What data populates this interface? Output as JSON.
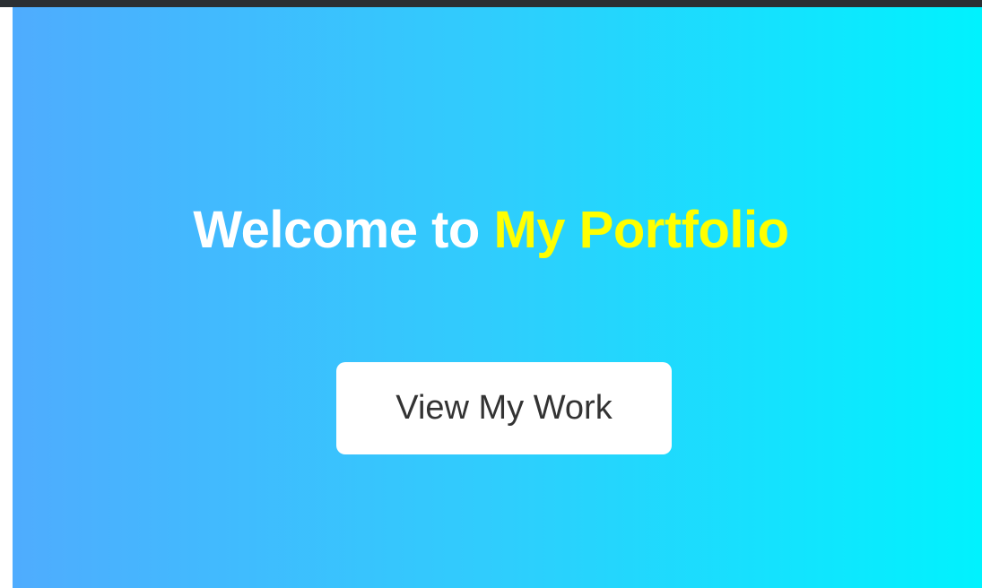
{
  "hero": {
    "title_lead": "Welcome to ",
    "title_accent": "My Portfolio",
    "cta_label": "View My Work"
  },
  "colors": {
    "gradient_start": "#4facfe",
    "gradient_end": "#00f2fe",
    "title_text": "#ffffff",
    "title_accent": "#ffff00",
    "button_bg": "#ffffff",
    "button_text": "#333333",
    "top_bar": "#2b2f33"
  }
}
